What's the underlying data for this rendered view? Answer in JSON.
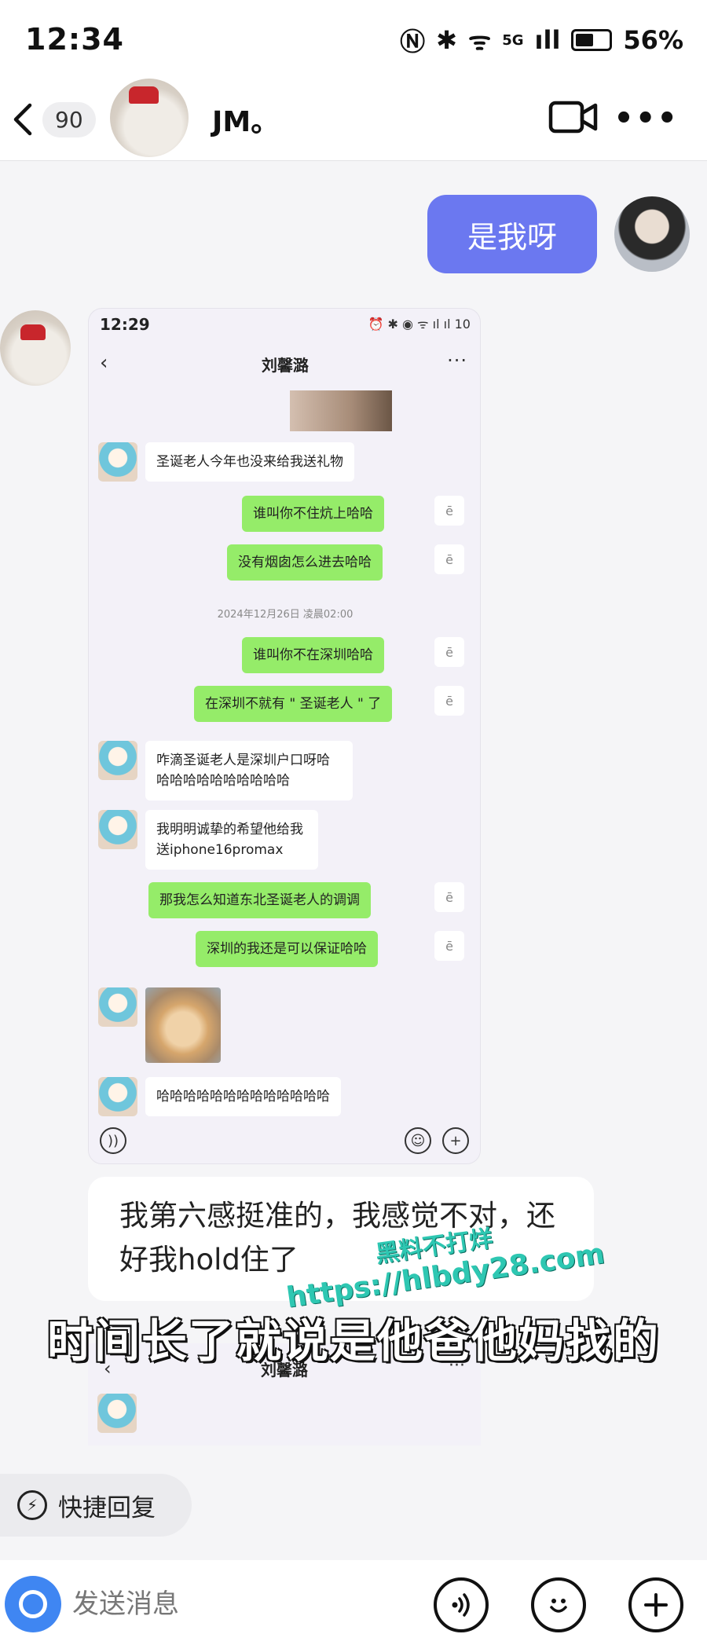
{
  "status_bar": {
    "time": "12:34",
    "network": "5G",
    "battery": "56%"
  },
  "header": {
    "unread_count": "90",
    "contact_name": "JM。"
  },
  "messages": {
    "outgoing_text": "是我呀",
    "incoming_text": "我第六感挺准的，我感觉不对，还好我hold住了"
  },
  "screenshot": {
    "time": "12:29",
    "status_icons": "⏰ ✱ ◉ ᯤ ıl ıl 10",
    "contact_name": "刘馨潞",
    "read_mark": "ē",
    "chat": [
      {
        "side": "in",
        "text": "圣诞老人今年也没来给我送礼物"
      },
      {
        "side": "out",
        "text": "谁叫你不住炕上哈哈"
      },
      {
        "side": "out",
        "text": "没有烟囱怎么进去哈哈"
      },
      {
        "side": "time",
        "text": "2024年12月26日 凌晨02:00"
      },
      {
        "side": "out",
        "text": "谁叫你不在深圳哈哈"
      },
      {
        "side": "out",
        "text": "在深圳不就有 \" 圣诞老人 \" 了"
      },
      {
        "side": "in",
        "text": "咋滴圣诞老人是深圳户口呀哈哈哈哈哈哈哈哈哈哈哈"
      },
      {
        "side": "in",
        "text": "我明明诚挚的希望他给我送iphone16promax"
      },
      {
        "side": "out",
        "text": "那我怎么知道东北圣诞老人的调调"
      },
      {
        "side": "out",
        "text": "深圳的我还是可以保证哈哈"
      },
      {
        "side": "in",
        "text": "哈哈哈哈哈哈哈哈哈哈哈哈哈"
      }
    ]
  },
  "screenshot2": {
    "contact_name": "刘馨潞"
  },
  "caption": "时间长了就说是他爸他妈找的",
  "watermark": {
    "line1": "黑料不打烊",
    "line2": "https://hlbdy28.com"
  },
  "quick_reply": {
    "label": "快捷回复"
  },
  "input_bar": {
    "placeholder": "发送消息"
  },
  "colors": {
    "outgoing_bubble": "#6b78f0",
    "wechat_green": "#95ec69",
    "camera_blue": "#3f86f2",
    "watermark": "#2ec7b2"
  }
}
